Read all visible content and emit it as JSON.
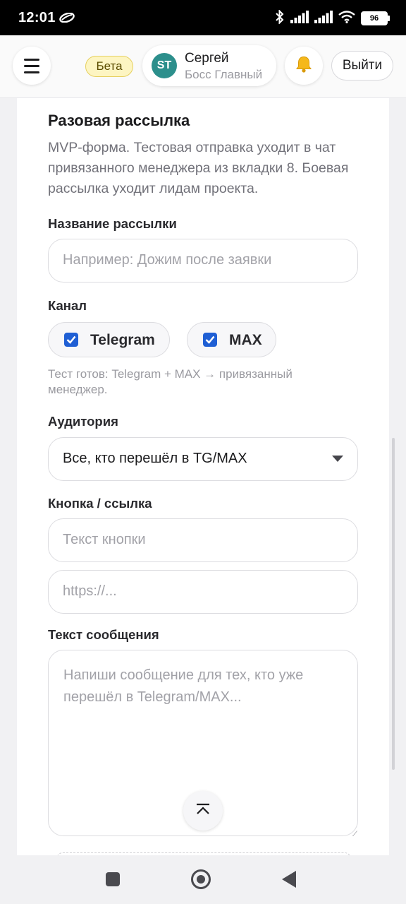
{
  "status_bar": {
    "time": "12:01",
    "battery": "96",
    "icons": [
      "cloud-icon",
      "bluetooth-icon",
      "signal-icon",
      "signal-icon",
      "wifi-icon",
      "battery-icon"
    ]
  },
  "header": {
    "menu_icon": "menu-icon",
    "beta_label": "Бета",
    "user": {
      "initials": "ST",
      "name": "Сергей",
      "role": "Босс Главный",
      "avatar_color": "#2c8f8c"
    },
    "bell_icon": "bell-icon",
    "logout_label": "Выйти"
  },
  "form": {
    "title": "Разовая рассылка",
    "description": "MVP-форма. Тестовая отправка уходит в чат привязанного менеджера из вкладки 8. Боевая рассылка уходит лидам проекта.",
    "name_field": {
      "label": "Название рассылки",
      "placeholder": "Например: Дожим после заявки",
      "value": ""
    },
    "channel": {
      "label": "Канал",
      "options": [
        {
          "label": "Telegram",
          "checked": true
        },
        {
          "label": "MAX",
          "checked": true
        }
      ],
      "hint": "Тест готов: Telegram + MAX → привязанный менеджер."
    },
    "audience": {
      "label": "Аудитория",
      "selected": "Все, кто перешёл в TG/MAX"
    },
    "button_link": {
      "label": "Кнопка / ссылка",
      "text_placeholder": "Текст кнопки",
      "url_placeholder": "https://..."
    },
    "message": {
      "label": "Текст сообщения",
      "placeholder": "Напиши сообщение для тех, кто уже перешёл в Telegram/MAX..."
    }
  },
  "colors": {
    "accent": "#1f5fd4",
    "beta_bg": "#fdf5c2",
    "beta_border": "#e6d060"
  },
  "nav_bar": {
    "icons": [
      "recents-icon",
      "home-icon",
      "back-icon"
    ]
  }
}
